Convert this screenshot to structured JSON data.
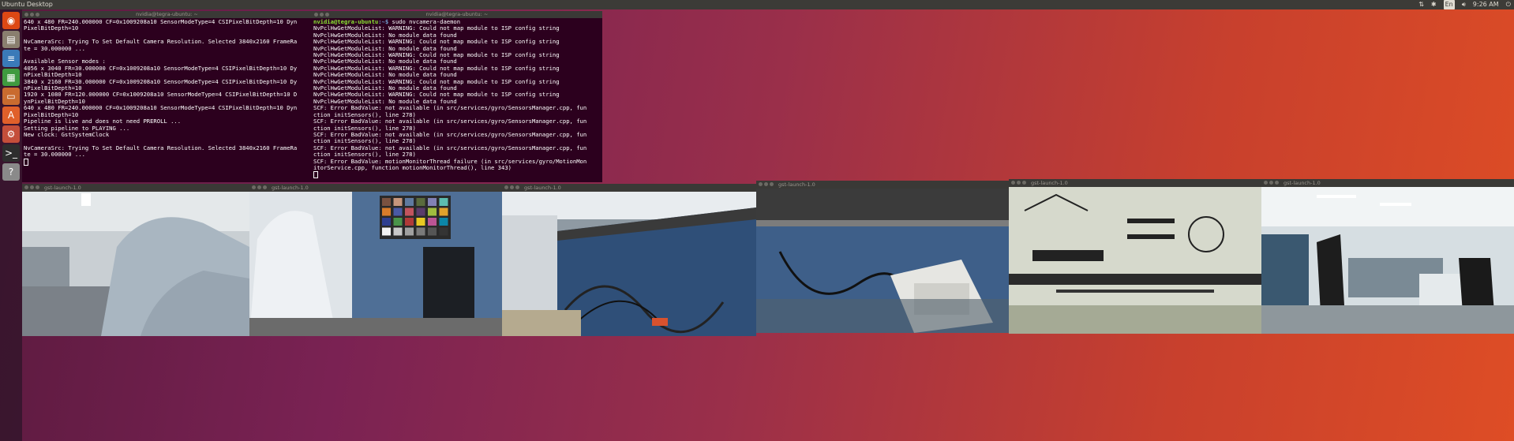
{
  "topbar": {
    "title": "Ubuntu Desktop",
    "clock": "9:26 AM",
    "lang": "En"
  },
  "launcher": {
    "items": [
      {
        "name": "ubuntu-dash-icon",
        "glyph": "◉",
        "color": "#dd4814"
      },
      {
        "name": "files-icon",
        "glyph": "▤",
        "color": "#8a7f6f"
      },
      {
        "name": "libreoffice-writer-icon",
        "glyph": "≡",
        "color": "#3a7ab8"
      },
      {
        "name": "libreoffice-calc-icon",
        "glyph": "▦",
        "color": "#3f9a3f"
      },
      {
        "name": "libreoffice-impress-icon",
        "glyph": "▭",
        "color": "#c96b2f"
      },
      {
        "name": "software-center-icon",
        "glyph": "A",
        "color": "#e0602a"
      },
      {
        "name": "system-settings-icon",
        "glyph": "⚙",
        "color": "#c44e3a"
      },
      {
        "name": "terminal-icon",
        "glyph": ">_",
        "color": "#2e2e2e"
      },
      {
        "name": "help-icon",
        "glyph": "?",
        "color": "#8a8a8a"
      }
    ]
  },
  "term1": {
    "title": "nvidia@tegra-ubuntu: ~",
    "lines": [
      "640 x 480 FR=240.000000 CF=0x1009208a10 SensorModeType=4 CSIPixelBitDepth=10 Dyn",
      "PixelBitDepth=10",
      "",
      "NvCameraSrc: Trying To Set Default Camera Resolution. Selected 3840x2160 FrameRa",
      "te = 30.000000 ...",
      "",
      "Available Sensor modes :",
      "4056 x 3040 FR=30.000000 CF=0x1009208a10 SensorModeType=4 CSIPixelBitDepth=10 Dy",
      "nPixelBitDepth=10",
      "3840 x 2160 FR=30.000000 CF=0x1009208a10 SensorModeType=4 CSIPixelBitDepth=10 Dy",
      "nPixelBitDepth=10",
      "1920 x 1080 FR=120.000000 CF=0x1009208a10 SensorModeType=4 CSIPixelBitDepth=10 D",
      "ynPixelBitDepth=10",
      "640 x 480 FR=240.000000 CF=0x1009208a10 SensorModeType=4 CSIPixelBitDepth=10 Dyn",
      "PixelBitDepth=10",
      "Pipeline is live and does not need PREROLL ...",
      "Setting pipeline to PLAYING ...",
      "New clock: GstSystemClock",
      "",
      "NvCameraSrc: Trying To Set Default Camera Resolution. Selected 3840x2160 FrameRa",
      "te = 30.000000 ..."
    ]
  },
  "term2": {
    "title": "nvidia@tegra-ubuntu: ~",
    "prompt_user": "nvidia@tegra-ubuntu",
    "prompt_path": ":~$ ",
    "command": "sudo nvcamera-daemon",
    "lines": [
      "NvPclHwGetModuleList: WARNING: Could not map module to ISP config string",
      "NvPclHwGetModuleList: No module data found",
      "NvPclHwGetModuleList: WARNING: Could not map module to ISP config string",
      "NvPclHwGetModuleList: No module data found",
      "NvPclHwGetModuleList: WARNING: Could not map module to ISP config string",
      "NvPclHwGetModuleList: No module data found",
      "NvPclHwGetModuleList: WARNING: Could not map module to ISP config string",
      "NvPclHwGetModuleList: No module data found",
      "NvPclHwGetModuleList: WARNING: Could not map module to ISP config string",
      "NvPclHwGetModuleList: No module data found",
      "NvPclHwGetModuleList: WARNING: Could not map module to ISP config string",
      "NvPclHwGetModuleList: No module data found",
      "SCF: Error BadValue: not available (in src/services/gyro/SensorsManager.cpp, fun",
      "ction initSensors(), line 278)",
      "SCF: Error BadValue: not available (in src/services/gyro/SensorsManager.cpp, fun",
      "ction initSensors(), line 278)",
      "SCF: Error BadValue: not available (in src/services/gyro/SensorsManager.cpp, fun",
      "ction initSensors(), line 278)",
      "SCF: Error BadValue: not available (in src/services/gyro/SensorsManager.cpp, fun",
      "ction initSensors(), line 278)",
      "SCF: Error BadValue: motionMonitorThread failure (in src/services/gyro/MotionMon",
      "itorService.cpp, function motionMonitorThread(), line 343)"
    ]
  },
  "videos": [
    {
      "title": "gst-launch-1.0",
      "scene": "person"
    },
    {
      "title": "gst-launch-1.0",
      "scene": "colorchart"
    },
    {
      "title": "gst-launch-1.0",
      "scene": "cables"
    },
    {
      "title": "gst-launch-1.0",
      "scene": "phone"
    },
    {
      "title": "gst-launch-1.0",
      "scene": "testchart"
    },
    {
      "title": "gst-launch-1.0",
      "scene": "office"
    }
  ]
}
